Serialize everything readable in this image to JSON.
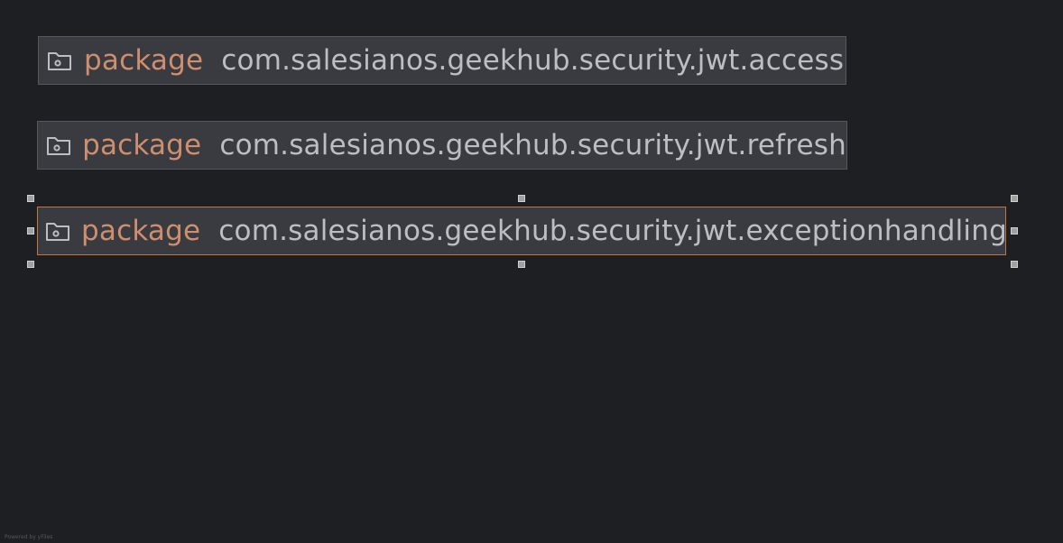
{
  "nodes": [
    {
      "keyword": "package",
      "name": "com.salesianos.geekhub.security.jwt.access",
      "icon": "package-folder-icon",
      "selected": false
    },
    {
      "keyword": "package",
      "name": "com.salesianos.geekhub.security.jwt.refresh",
      "icon": "package-folder-icon",
      "selected": false
    },
    {
      "keyword": "package",
      "name": "com.salesianos.geekhub.security.jwt.exceptionhandling",
      "icon": "package-folder-icon",
      "selected": true
    }
  ],
  "colors": {
    "background": "#1e1f22",
    "node_fill": "#393b40",
    "node_border": "#55575c",
    "selected_border": "#c0763e",
    "keyword": "#cf8e6d",
    "name": "#bcbec4"
  },
  "footer": "Powered by yFiles"
}
